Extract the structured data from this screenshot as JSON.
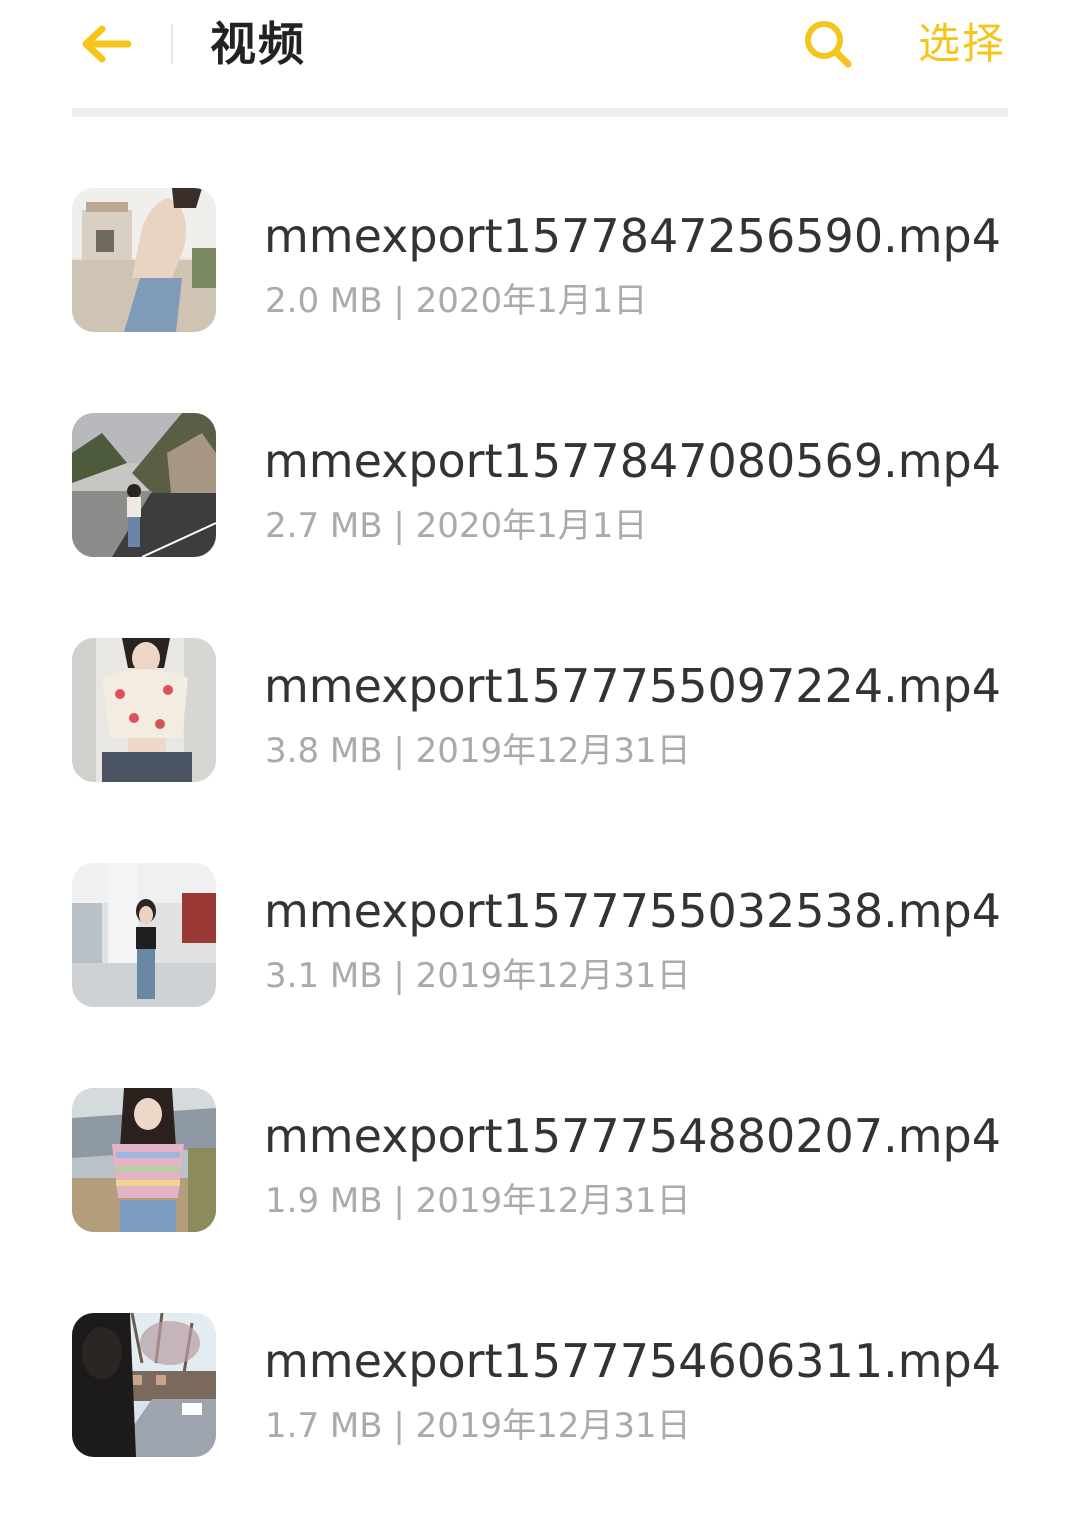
{
  "header": {
    "title": "视频",
    "select_label": "选择",
    "back_icon": "arrow-left-icon",
    "search_icon": "search-icon",
    "accent_color": "#f6c51b"
  },
  "files": [
    {
      "name": "mmexport1577847256590.mp4",
      "size": "2.0 MB",
      "date": "2020年1月1日",
      "meta": "2.0 MB | 2020年1月1日",
      "thumb_icon": "video-thumbnail"
    },
    {
      "name": "mmexport1577847080569.mp4",
      "size": "2.7 MB",
      "date": "2020年1月1日",
      "meta": "2.7 MB | 2020年1月1日",
      "thumb_icon": "video-thumbnail"
    },
    {
      "name": "mmexport1577755097224.mp4",
      "size": "3.8 MB",
      "date": "2019年12月31日",
      "meta": "3.8 MB | 2019年12月31日",
      "thumb_icon": "video-thumbnail"
    },
    {
      "name": "mmexport1577755032538.mp4",
      "size": "3.1 MB",
      "date": "2019年12月31日",
      "meta": "3.1 MB | 2019年12月31日",
      "thumb_icon": "video-thumbnail"
    },
    {
      "name": "mmexport1577754880207.mp4",
      "size": "1.9 MB",
      "date": "2019年12月31日",
      "meta": "1.9 MB | 2019年12月31日",
      "thumb_icon": "video-thumbnail"
    },
    {
      "name": "mmexport1577754606311.mp4",
      "size": "1.7 MB",
      "date": "2019年12月31日",
      "meta": "1.7 MB | 2019年12月31日",
      "thumb_icon": "video-thumbnail"
    }
  ]
}
